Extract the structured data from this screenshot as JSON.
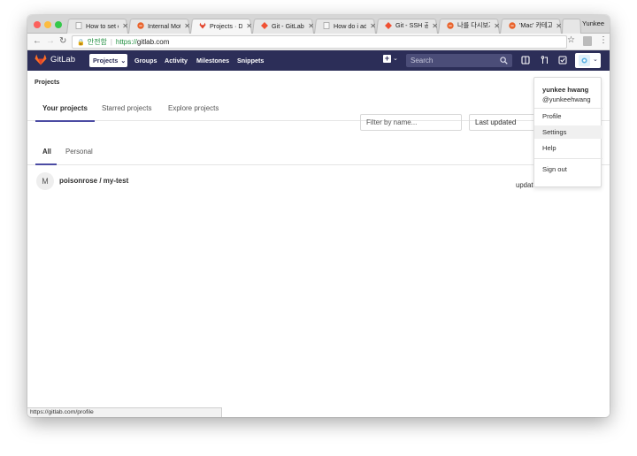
{
  "browser": {
    "tabs": [
      {
        "title": "How to set c",
        "favicon": "page-icon",
        "active": false
      },
      {
        "title": "Internal Moti",
        "favicon": "stack-icon",
        "active": false
      },
      {
        "title": "Projects · Da",
        "favicon": "gitlab-icon",
        "active": true
      },
      {
        "title": "Git - GitLab",
        "favicon": "git-icon",
        "active": false
      },
      {
        "title": "How do i add",
        "favicon": "page-icon",
        "active": false
      },
      {
        "title": "Git - SSH 공",
        "favicon": "git-icon",
        "active": false
      },
      {
        "title": "나를 다시보기",
        "favicon": "stack-icon",
        "active": false
      },
      {
        "title": "'Mac' 카테고",
        "favicon": "stack-icon",
        "active": false
      }
    ],
    "profile_name": "Yunkee",
    "secure_label": "안전함",
    "url_scheme": "https://",
    "url_host": "gitlab.com",
    "status_url": "https://gitlab.com/profile",
    "colors": {
      "close": "#fc605c",
      "minimize": "#fdbc40",
      "maximize": "#34c84a"
    }
  },
  "gitlab_nav": {
    "logo_text": "GitLab",
    "projects_label": "Projects",
    "groups_label": "Groups",
    "activity_label": "Activity",
    "milestones_label": "Milestones",
    "snippets_label": "Snippets",
    "search_placeholder": "Search",
    "nav_color": "#2c2e58"
  },
  "page": {
    "breadcrumb": "Projects",
    "tabs": [
      "Your projects",
      "Starred projects",
      "Explore projects"
    ],
    "filter_placeholder": "Filter by name...",
    "sort_label": "Last updated",
    "subtabs": [
      "All",
      "Personal"
    ],
    "projects": [
      {
        "avatar_letter": "M",
        "name": "poisonrose / my-test",
        "updated_text": "updat"
      }
    ]
  },
  "user_menu": {
    "name": "yunkee hwang",
    "username": "@yunkeehwang",
    "items": [
      "Profile",
      "Settings",
      "Help"
    ],
    "signout": "Sign out"
  }
}
